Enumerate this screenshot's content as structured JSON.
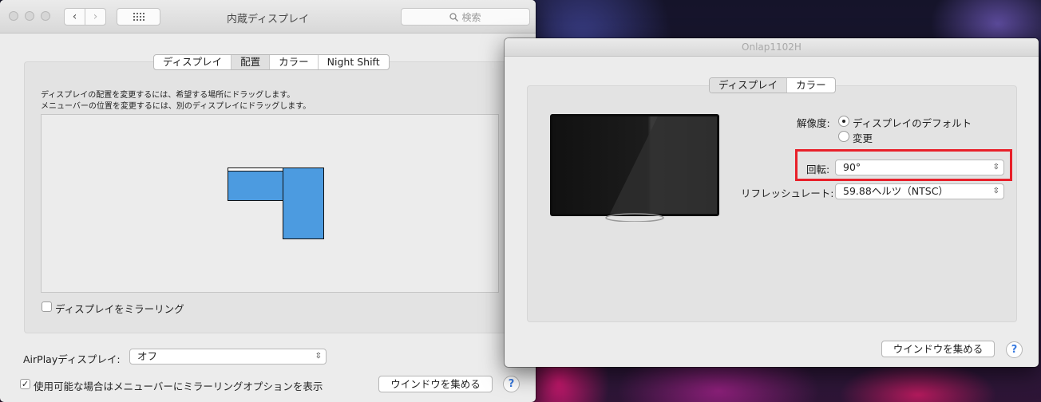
{
  "window1": {
    "title": "内蔵ディスプレイ",
    "search_placeholder": "検索",
    "tabs": [
      {
        "label": "ディスプレイ"
      },
      {
        "label": "配置"
      },
      {
        "label": "カラー"
      },
      {
        "label": "Night Shift"
      }
    ],
    "instructions_line1": "ディスプレイの配置を変更するには、希望する場所にドラッグします。",
    "instructions_line2": "メニューバーの位置を変更するには、別のディスプレイにドラッグします。",
    "mirror_label": "ディスプレイをミラーリング",
    "airplay_label": "AirPlayディスプレイ:",
    "airplay_value": "オフ",
    "menubar_option_label": "使用可能な場合はメニューバーにミラーリングオプションを表示",
    "gather_button": "ウインドウを集める",
    "help": "?"
  },
  "window2": {
    "title": "Onlap1102H",
    "tabs": [
      {
        "label": "ディスプレイ"
      },
      {
        "label": "カラー"
      }
    ],
    "resolution_label": "解像度:",
    "resolution_default": "ディスプレイのデフォルト",
    "resolution_scaled": "変更",
    "rotation_label": "回転:",
    "rotation_value": "90°",
    "refresh_label": "リフレッシュレート:",
    "refresh_value": "59.88ヘルツ（NTSC）",
    "gather_button": "ウインドウを集める",
    "help": "?"
  },
  "colors": {
    "highlight": "#e8202a",
    "display_box": "#4c9be0"
  }
}
